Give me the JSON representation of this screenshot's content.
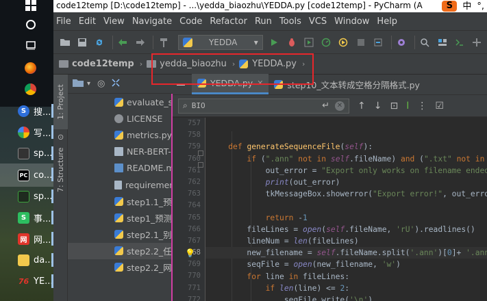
{
  "window": {
    "title": "code12temp [D:\\code12temp] - ...\\yedda_biaozhu\\YEDDA.py [code12temp] - PyCharm (A",
    "ime_label": "中",
    "ime_dot": "°,",
    "sogou_label": "S"
  },
  "taskbar": {
    "items": [
      {
        "name": "windows-start",
        "label": ""
      },
      {
        "name": "cortana",
        "label": ""
      },
      {
        "name": "task-view",
        "label": ""
      },
      {
        "name": "firefox",
        "label": ""
      },
      {
        "name": "chrome",
        "label": ""
      },
      {
        "name": "sogou-search",
        "label": "搜..."
      },
      {
        "name": "write-app",
        "label": "写..."
      },
      {
        "name": "sp-app",
        "label": "sp..."
      },
      {
        "name": "pycharm",
        "label": "co..."
      },
      {
        "name": "sp-app-2",
        "label": "sp..."
      },
      {
        "name": "evernote",
        "label": "事..."
      },
      {
        "name": "netease",
        "label": "网..."
      },
      {
        "name": "folder",
        "label": "da..."
      },
      {
        "name": "yedda",
        "label": "YE..."
      }
    ]
  },
  "menubar": [
    "File",
    "Edit",
    "View",
    "Navigate",
    "Code",
    "Refactor",
    "Run",
    "Tools",
    "VCS",
    "Window",
    "Help"
  ],
  "toolbar": {
    "run_config": "YEDDA"
  },
  "navbar": {
    "project": "code12temp",
    "folder": "yedda_biaozhu",
    "file": "YEDDA.py"
  },
  "tool_windows": {
    "project_tab": "1: Project",
    "structure_tab": "7: Structure"
  },
  "project_files": [
    {
      "name": "evaluate_si",
      "type": "py"
    },
    {
      "name": "LICENSE",
      "type": "lic"
    },
    {
      "name": "metrics.py",
      "type": "py"
    },
    {
      "name": "NER-BERT-",
      "type": "ipynb"
    },
    {
      "name": "README.m",
      "type": "md"
    },
    {
      "name": "requiremen",
      "type": "txt"
    },
    {
      "name": "step1.1_预",
      "type": "py"
    },
    {
      "name": "step1_预测",
      "type": "py"
    },
    {
      "name": "step2.1_别",
      "type": "py"
    },
    {
      "name": "step2.2_任",
      "type": "py",
      "selected": true
    },
    {
      "name": "step2.2_网",
      "type": "py"
    }
  ],
  "editor": {
    "tabs": [
      {
        "label": "YEDDA.py",
        "active": true
      },
      {
        "label": "step10_文本转成空格分隔格式.py",
        "active": false
      }
    ],
    "find": {
      "value": "BIO"
    },
    "line_numbers": [
      "757",
      "758",
      "759",
      "760",
      "761",
      "762",
      "763",
      "764",
      "765",
      "766",
      "767",
      "768",
      "769",
      "770",
      "771",
      "772"
    ],
    "current_line": "768"
  }
}
